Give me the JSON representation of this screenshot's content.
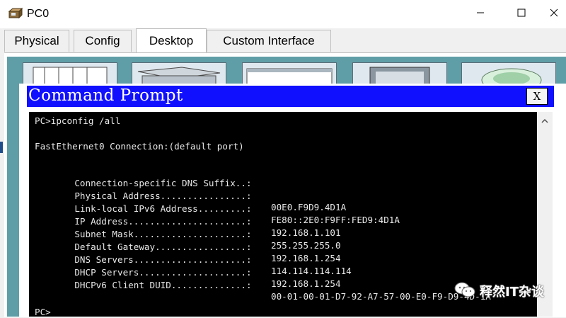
{
  "window": {
    "title": "PC0",
    "icon": "pc-app-icon"
  },
  "window_controls": {
    "minimize": "minimize-icon",
    "maximize": "maximize-icon",
    "close": "close-icon"
  },
  "tabs": [
    {
      "label": "Physical",
      "active": false
    },
    {
      "label": "Config",
      "active": false
    },
    {
      "label": "Desktop",
      "active": true
    },
    {
      "label": "Custom Interface",
      "active": false
    }
  ],
  "command_prompt": {
    "title": "Command Prompt",
    "close_label": "X",
    "command_line": "PC>ipconfig /all",
    "connection_header": "FastEthernet0 Connection:(default port)",
    "config": [
      {
        "label": "Connection-specific DNS Suffix..:",
        "value": ""
      },
      {
        "label": "Physical Address................:",
        "value": "00E0.F9D9.4D1A"
      },
      {
        "label": "Link-local IPv6 Address.........:",
        "value": "FE80::2E0:F9FF:FED9:4D1A"
      },
      {
        "label": "IP Address......................:",
        "value": "192.168.1.101"
      },
      {
        "label": "Subnet Mask.....................:",
        "value": "255.255.255.0"
      },
      {
        "label": "Default Gateway.................:",
        "value": "192.168.1.254"
      },
      {
        "label": "DNS Servers.....................:",
        "value": "114.114.114.114"
      },
      {
        "label": "DHCP Servers....................:",
        "value": "192.168.1.254"
      },
      {
        "label": "DHCPv6 Client DUID..............:",
        "value": "00-01-00-01-D7-92-A7-57-00-E0-F9-D9-4D-1A"
      }
    ],
    "prompt": "PC>"
  },
  "watermark": {
    "text": "释然IT杂谈",
    "icon": "wechat-icon"
  },
  "colors": {
    "cmd_title_bar": "#1010ff",
    "console_bg": "#000000",
    "console_text": "#e8e8e8",
    "desktop_bg": "#5f9ea7"
  }
}
